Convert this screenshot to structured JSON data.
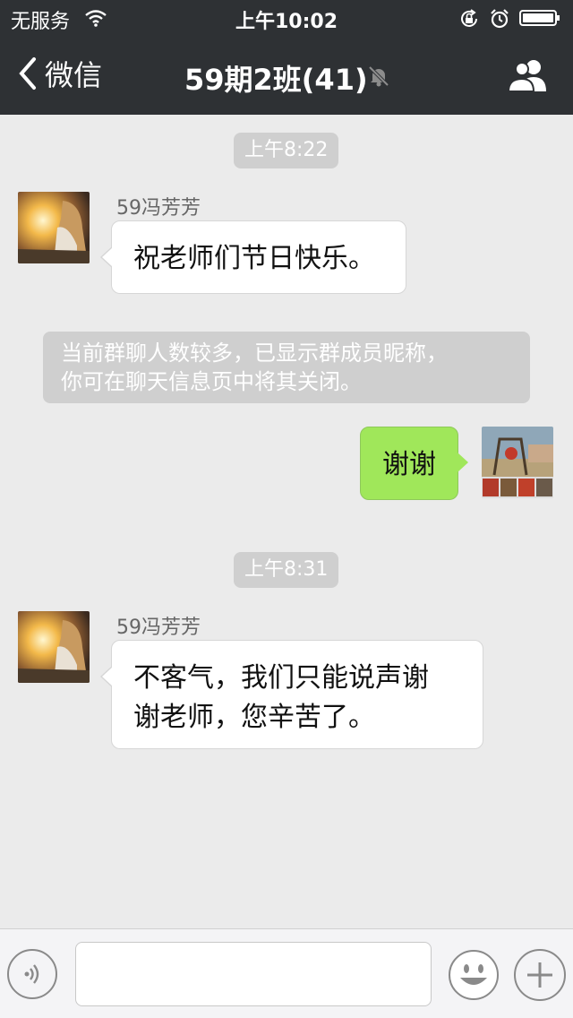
{
  "status_bar": {
    "carrier": "无服务",
    "time": "上午10:02",
    "icons": [
      "wifi-icon",
      "orientation-lock-icon",
      "alarm-icon",
      "battery-icon"
    ]
  },
  "nav": {
    "back_label": "微信",
    "title": "59期2班(41)",
    "icons": [
      "back-chevron-icon",
      "mute-bell-icon",
      "group-members-icon"
    ]
  },
  "chat": {
    "timestamps": [
      "上午8:22",
      "上午8:31"
    ],
    "messages": [
      {
        "sender": "59冯芳芳",
        "text": "祝老师们节日快乐。"
      },
      {
        "text": "谢谢"
      },
      {
        "sender": "59冯芳芳",
        "line1": "不客气，我们只能说声谢",
        "line2": "谢老师，您辛苦了。"
      }
    ],
    "system_notice": {
      "line1": "当前群聊人数较多，已显示群成员昵称，",
      "line2": "你可在聊天信息页中将其关闭。"
    }
  },
  "input_bar": {
    "value": "",
    "icons": [
      "voice-icon",
      "emoji-icon",
      "plus-icon"
    ]
  },
  "colors": {
    "header_bg": "#2e3134",
    "chat_bg": "#ebebeb",
    "sent_bubble": "#a0e75a",
    "received_bubble": "#ffffff",
    "timestamp_pill": "#cfcfcf"
  }
}
